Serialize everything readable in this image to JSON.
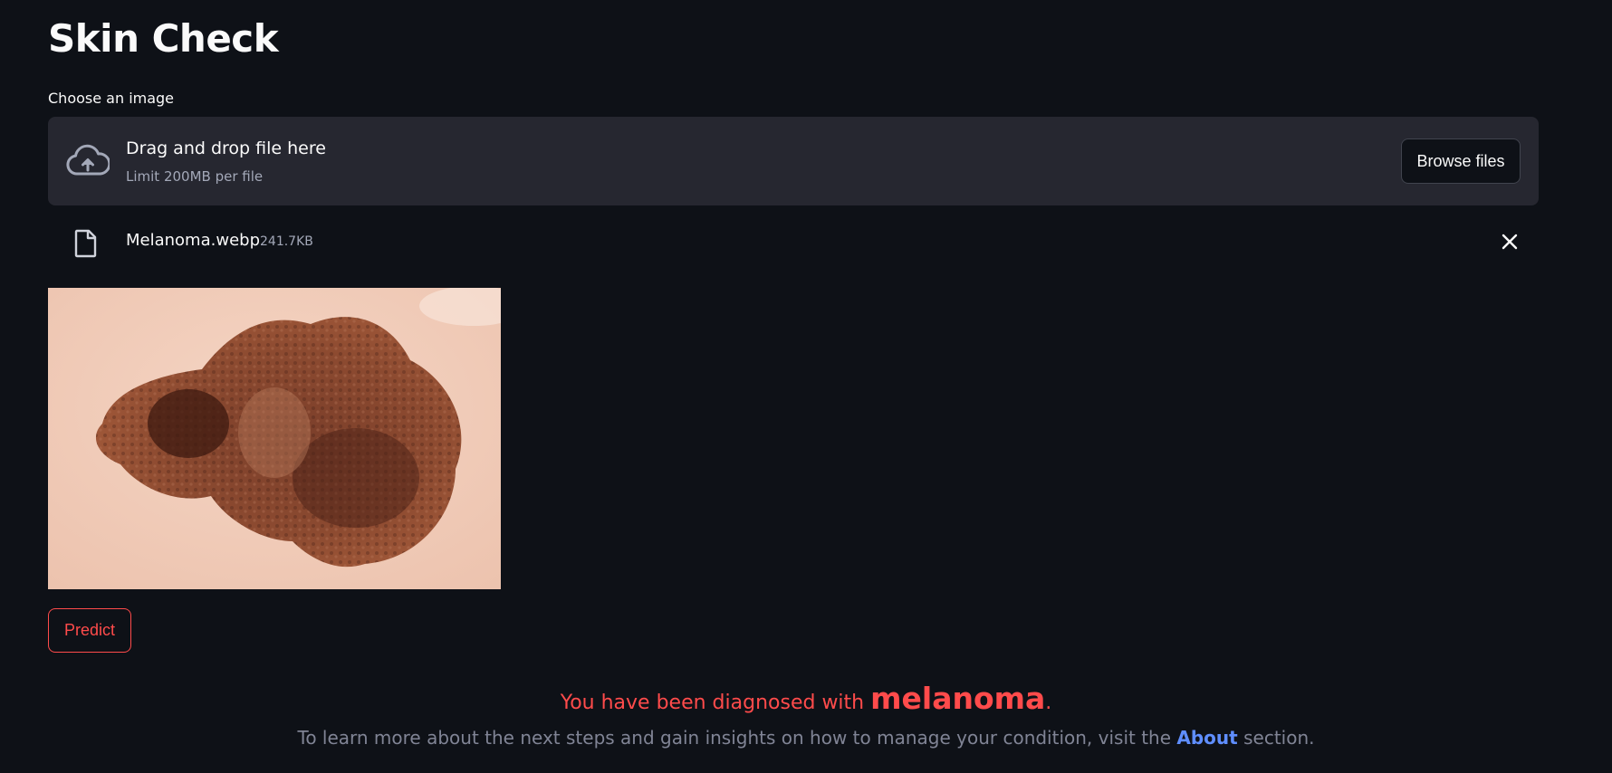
{
  "page": {
    "title": "Skin Check"
  },
  "uploader": {
    "label": "Choose an image",
    "drop_text": "Drag and drop file here",
    "limit_text": "Limit 200MB per file",
    "browse_label": "Browse files",
    "icon": "cloud-upload-icon"
  },
  "file": {
    "name": "Melanoma.webp",
    "size": "241.7KB",
    "icon": "file-icon",
    "remove_icon": "close-icon"
  },
  "predict": {
    "label": "Predict"
  },
  "result": {
    "prefix": "You have been diagnosed with ",
    "diagnosis": "melanoma",
    "suffix": "."
  },
  "info": {
    "prefix": "To learn more about the next steps and gain insights on how to manage your condition, visit the ",
    "link": "About",
    "suffix": " section."
  },
  "colors": {
    "background": "#0e1117",
    "dropzone": "#262730",
    "accent": "#ff4b4b",
    "link": "#5f8eff",
    "muted": "#808495"
  }
}
